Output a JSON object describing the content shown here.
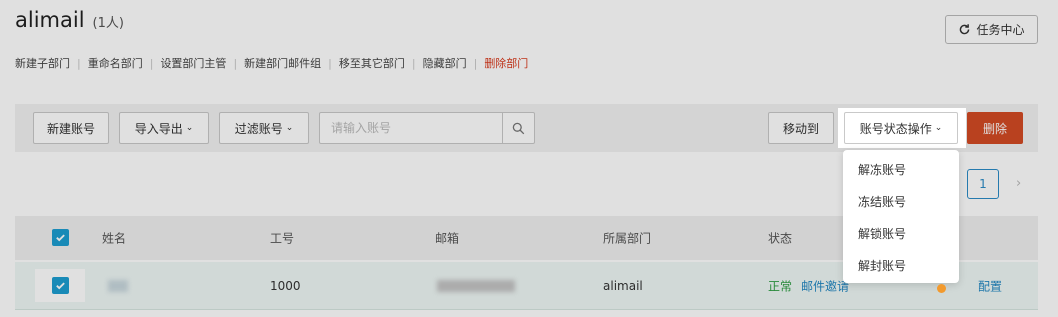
{
  "header": {
    "title": "alimail",
    "count": "(1人)"
  },
  "task_center": {
    "label": "任务中心",
    "icon": "refresh-icon"
  },
  "dept_actions": [
    {
      "label": "新建子部门",
      "danger": false
    },
    {
      "label": "重命名部门",
      "danger": false
    },
    {
      "label": "设置部门主管",
      "danger": false
    },
    {
      "label": "新建部门邮件组",
      "danger": false
    },
    {
      "label": "移至其它部门",
      "danger": false
    },
    {
      "label": "隐藏部门",
      "danger": false
    },
    {
      "label": "删除部门",
      "danger": true
    }
  ],
  "toolbar": {
    "new_account": "新建账号",
    "import_export": "导入导出",
    "filter_account": "过滤账号",
    "search_placeholder": "请输入账号",
    "move_to": "移动到",
    "status_ops": "账号状态操作",
    "delete": "删除"
  },
  "pagination": {
    "current": "1"
  },
  "table": {
    "headers": {
      "name": "姓名",
      "employee_id": "工号",
      "email": "邮箱",
      "department": "所属部门",
      "status": "状态"
    },
    "rows": [
      {
        "employee_id": "1000",
        "department": "alimail",
        "status": "正常",
        "invite": "邮件邀请",
        "config": "配置"
      }
    ]
  },
  "status_menu": {
    "items": [
      "解冻账号",
      "冻结账号",
      "解锁账号",
      "解封账号"
    ]
  },
  "colors": {
    "accent": "#1d9ed1",
    "danger": "#d34a24",
    "ok": "#2f9e44",
    "link": "#2287c2"
  }
}
